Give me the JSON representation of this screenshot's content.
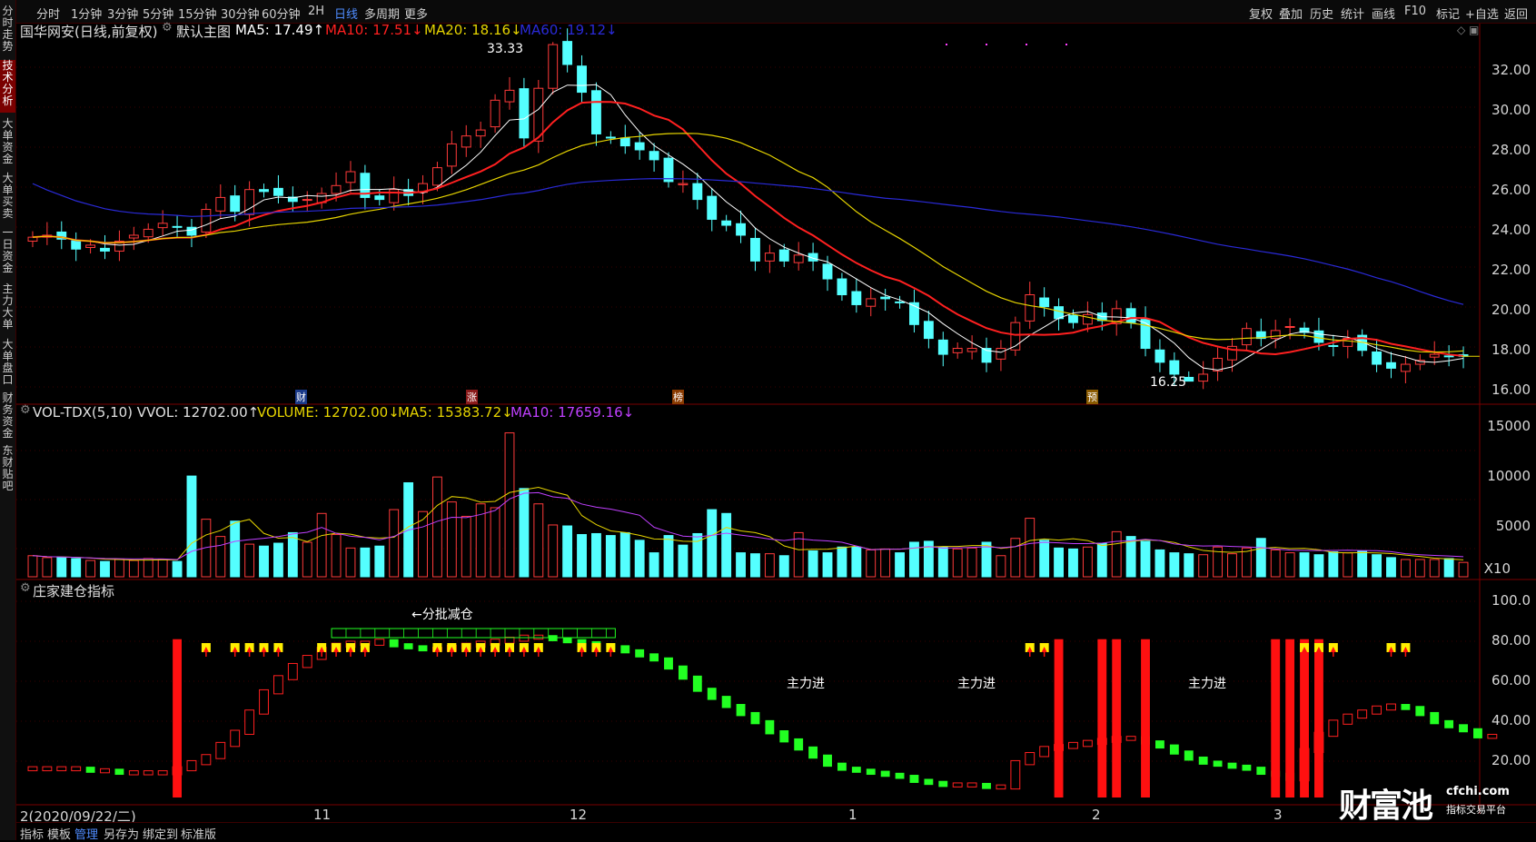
{
  "topbar": {
    "left": [
      "分时",
      "1分钟",
      "3分钟",
      "5分钟",
      "15分钟",
      "30分钟",
      "60分钟",
      "2H",
      "日线",
      "多周期",
      "更多"
    ],
    "active": "日线",
    "right": [
      "复权",
      "叠加",
      "历史",
      "统计",
      "画线",
      "F10",
      "标记",
      "+自选",
      "返回"
    ]
  },
  "sidebar": {
    "items": [
      "分时走势",
      "技术分析",
      "大单资金",
      "大单买卖",
      "一日资金",
      "主力大单",
      "大单盘口",
      "财务资金",
      "东财贴吧"
    ],
    "active": "技术分析"
  },
  "main_header": {
    "title": "国华网安(日线,前复权)",
    "template": "默认主图",
    "ma5": "MA5: 17.49↑",
    "ma10": "MA10: 17.51↓",
    "ma20": "MA20: 18.16↓",
    "ma60": "MA60: 19.12↓"
  },
  "vol_header": {
    "name": "VOL-TDX(5,10) VVOL: 12702.00↑",
    "volume": "VOLUME: 12702.00↓",
    "ma5": "MA5: 15383.72↓",
    "ma10": "MA10: 17659.16↓"
  },
  "ind_header": {
    "name": "庄家建仓指标"
  },
  "annotations": {
    "high": "33.33",
    "low": "16.25",
    "split_reduce": "←分批减仓",
    "main_in": "主力进",
    "vol_scale": "X10",
    "markers": [
      "财",
      "涨",
      "榜",
      "预"
    ]
  },
  "date_label": "2(2020/09/22/二)",
  "x_labels": [
    "11",
    "12",
    "1",
    "2",
    "3"
  ],
  "price_axis": [
    "32.00",
    "30.00",
    "28.00",
    "26.00",
    "24.00",
    "22.00",
    "20.00",
    "18.00",
    "16.00"
  ],
  "vol_axis": [
    "15000",
    "10000",
    "5000"
  ],
  "ind_axis": [
    "100.0",
    "80.00",
    "60.00",
    "40.00",
    "20.00"
  ],
  "bottombar": {
    "items": [
      "指标",
      "模板",
      "管理",
      "另存为",
      "绑定到",
      "标准版"
    ],
    "active": "管理"
  },
  "watermark": {
    "brand": "财富池",
    "site": "cfchi.com",
    "slogan": "指标交易平台"
  },
  "colors": {
    "up": "#ff3a3a",
    "down": "#54ffff",
    "ma5": "#ffffff",
    "ma10": "#ff2020",
    "ma20": "#e6d400",
    "ma60": "#2a2ad8",
    "vol_ma5": "#e6d400",
    "vol_ma10": "#c040ff",
    "ind_up": "#ff2020",
    "ind_down": "#22ff22",
    "signal": "#ffee00"
  },
  "chart_data": [
    {
      "type": "candlestick",
      "title": "国华网安(日线,前复权)",
      "ylim": [
        15.5,
        33.8
      ],
      "high": 33.33,
      "low": 16.25,
      "close": [
        23.5,
        23.6,
        23.4,
        22.9,
        23.1,
        22.8,
        23.3,
        23.6,
        23.9,
        24.2,
        24.0,
        23.6,
        24.9,
        25.5,
        24.8,
        25.9,
        25.8,
        25.6,
        25.3,
        25.4,
        25.7,
        26.1,
        26.8,
        25.5,
        25.4,
        25.9,
        25.6,
        26.2,
        27.0,
        28.2,
        28.6,
        28.9,
        30.4,
        30.9,
        28.5,
        31.0,
        33.2,
        32.2,
        30.8,
        28.7,
        28.5,
        28.1,
        27.9,
        27.4,
        26.3,
        26.2,
        25.4,
        24.4,
        24.1,
        23.6,
        22.3,
        22.7,
        22.3,
        22.6,
        22.3,
        21.4,
        20.6,
        20.1,
        20.4,
        20.4,
        20.2,
        19.1,
        18.4,
        17.6,
        17.9,
        17.9,
        17.2,
        17.9,
        19.2,
        20.6,
        20.0,
        19.4,
        19.2,
        19.6,
        19.3,
        19.9,
        19.2,
        17.9,
        17.2,
        16.6,
        16.25,
        16.6,
        17.4,
        18.0,
        18.9,
        18.4,
        18.8,
        19.0,
        18.7,
        18.2,
        18.0,
        18.4,
        17.8,
        17.1,
        16.9,
        17.1,
        17.3,
        17.6,
        17.5,
        17.5
      ],
      "volume": [
        2200,
        2000,
        2000,
        1900,
        1700,
        1600,
        1800,
        1700,
        1900,
        1800,
        1600,
        10500,
        6000,
        4200,
        5800,
        3400,
        3200,
        3500,
        4600,
        3600,
        6600,
        4400,
        3000,
        3000,
        3200,
        7000,
        9800,
        6800,
        10400,
        7800,
        6300,
        7600,
        7200,
        15000,
        9200,
        7600,
        5400,
        5300,
        4400,
        4500,
        4300,
        4600,
        3800,
        2500,
        4300,
        3300,
        4500,
        7000,
        6600,
        2500,
        2400,
        2400,
        2200,
        4600,
        2700,
        2500,
        3100,
        3100,
        2800,
        2900,
        2500,
        3600,
        3700,
        3100,
        2900,
        3000,
        3600,
        2200,
        4000,
        6100,
        3800,
        3000,
        2900,
        3100,
        3500,
        4700,
        4200,
        3700,
        2800,
        2500,
        2400,
        2300,
        3100,
        2400,
        3000,
        4000,
        2800,
        2500,
        2500,
        2300,
        2600,
        2500,
        2700,
        2300,
        2000,
        1800,
        1800,
        1800,
        1900,
        1500
      ]
    },
    {
      "type": "bar",
      "title": "庄家建仓指标",
      "ylim": [
        0,
        105
      ],
      "values": [
        17,
        17,
        17,
        17,
        16,
        16,
        15,
        15,
        15,
        15,
        17,
        20,
        23,
        29,
        35,
        45,
        55,
        62,
        68,
        72,
        76,
        78,
        79,
        79,
        80,
        78,
        77,
        76,
        76,
        77,
        78,
        79,
        80,
        81,
        82,
        82,
        81,
        80,
        79,
        78,
        77,
        75,
        73,
        71,
        67,
        62,
        56,
        52,
        48,
        44,
        40,
        35,
        31,
        27,
        23,
        19,
        17,
        16,
        15,
        14,
        13,
        11,
        10,
        9,
        9,
        9,
        8,
        8,
        20,
        24,
        27,
        28,
        29,
        30,
        31,
        32,
        32,
        30,
        28,
        25,
        22,
        20,
        19,
        18,
        17,
        15,
        14,
        12,
        26,
        34,
        40,
        43,
        45,
        47,
        48,
        47,
        44,
        40,
        38,
        36,
        33,
        33
      ],
      "main_in_days": [
        71,
        74,
        75,
        77,
        86,
        87,
        88,
        89,
        105,
        106
      ]
    }
  ]
}
